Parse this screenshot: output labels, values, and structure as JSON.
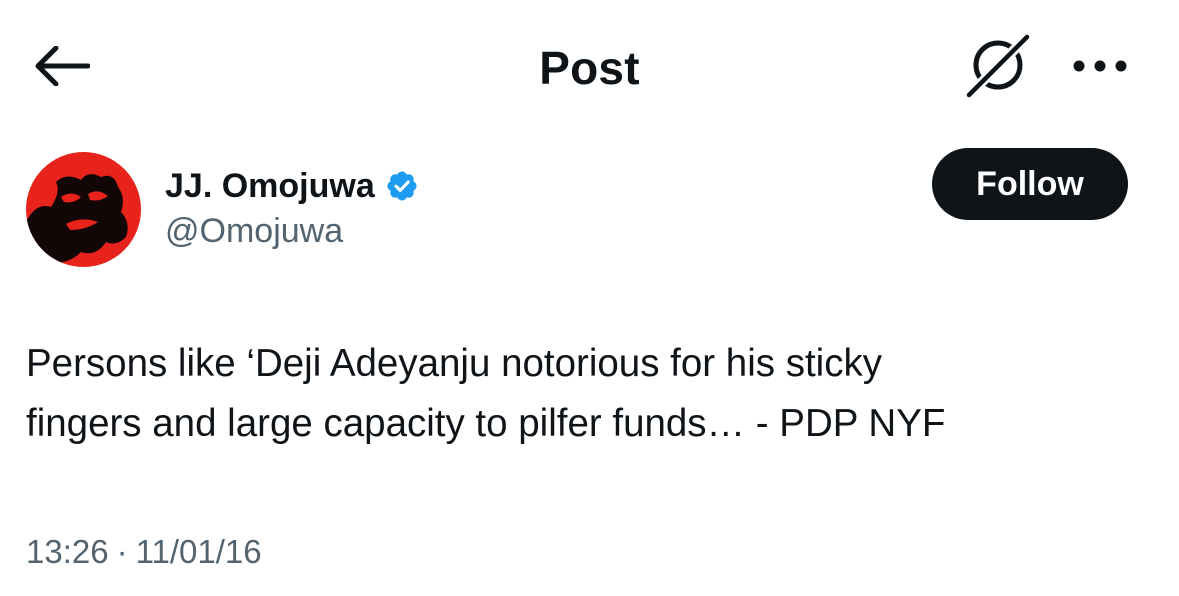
{
  "header": {
    "title": "Post",
    "back_icon": "arrow-left-icon",
    "grok_icon": "grok-icon",
    "more_icon": "more-horizontal-icon"
  },
  "author": {
    "display_name": "JJ. Omojuwa",
    "handle": "@Omojuwa",
    "verified": true,
    "verified_color": "#1d9bf0",
    "avatar_accent": "#e8231b"
  },
  "follow_button": {
    "label": "Follow"
  },
  "tweet": {
    "text": "Persons like ‘Deji Adeyanju notorious for his sticky\nfingers and large capacity to pilfer funds… - PDP NYF",
    "time": "13:26",
    "separator": "·",
    "date": "11/01/16"
  },
  "colors": {
    "text_primary": "#0f1419",
    "text_secondary": "#536471",
    "background": "#ffffff"
  }
}
